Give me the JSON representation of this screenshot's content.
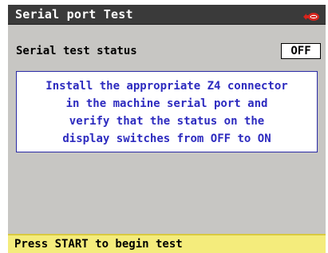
{
  "window": {
    "title": "Serial port Test",
    "logo_icon": "brand-logo-icon",
    "logo_color": "#d6241c"
  },
  "status": {
    "label": "Serial test status",
    "value": "OFF"
  },
  "message": {
    "lines": [
      "Install the appropriate Z4 connector",
      "in the machine serial port and",
      "verify that the status on the",
      "display switches from OFF to ON"
    ],
    "text_color": "#2d2bbf"
  },
  "statusbar": {
    "text": "Press START to begin test",
    "background": "#f4ec7c"
  }
}
